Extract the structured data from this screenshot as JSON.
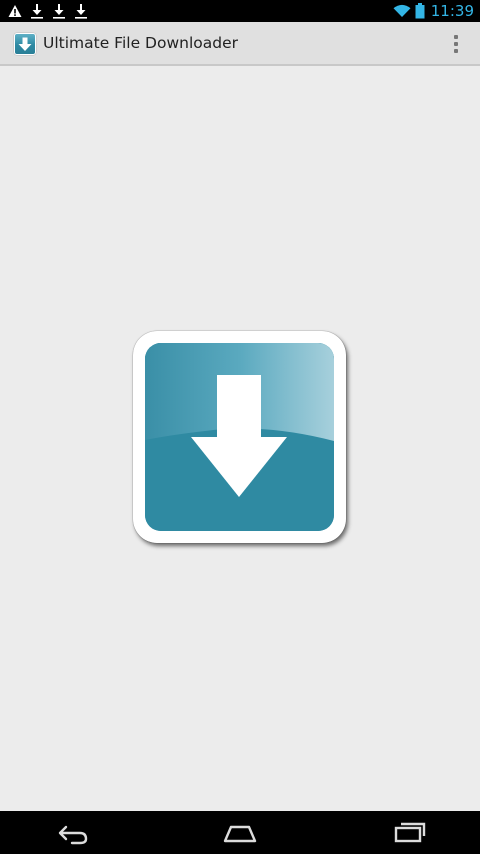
{
  "status_bar": {
    "time": "11:39",
    "left_icons": [
      "warning-icon",
      "download-icon",
      "download-icon",
      "download-icon"
    ],
    "right_icons": [
      "wifi-icon",
      "battery-icon"
    ],
    "accent_color": "#33b5e5"
  },
  "action_bar": {
    "title": "Ultimate File Downloader",
    "app_icon": "download-app-icon",
    "overflow_icon": "overflow-menu-icon"
  },
  "content": {
    "logo": "download-arrow-logo",
    "logo_color": "#2f8aa2"
  },
  "nav_bar": {
    "buttons": [
      "back-icon",
      "home-icon",
      "recent-apps-icon"
    ]
  }
}
